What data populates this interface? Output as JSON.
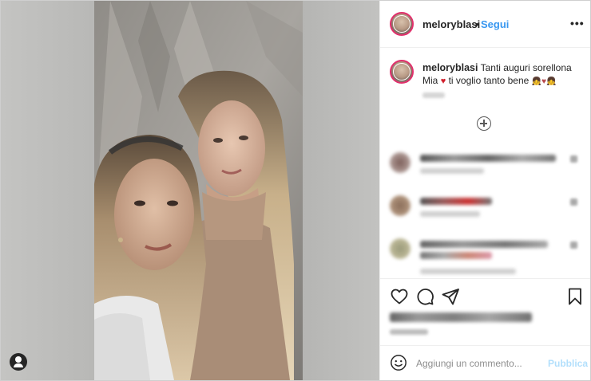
{
  "post": {
    "username": "meloryblasi",
    "dot": "•",
    "follow_label": "Segui",
    "more_label": "•••",
    "caption_username": "meloryblasi",
    "caption_text_1": "Tanti auguri sorellona",
    "caption_text_2_prefix": "Mia",
    "caption_heart": "♥",
    "caption_text_2_suffix": "ti voglio tanto bene",
    "caption_emojis": "👧♥👧"
  },
  "comment_box": {
    "placeholder": "Aggiungi un commento...",
    "publish_label": "Pubblica"
  },
  "icons": {
    "heart": "heart-icon",
    "comment": "comment-icon",
    "share": "paper-plane-icon",
    "save": "bookmark-icon",
    "emoji": "smiley-icon",
    "load_more": "plus-circle-icon",
    "user_tag": "user-tag-icon"
  },
  "colors": {
    "accent": "#3897f0",
    "publish_disabled": "#b2dffc",
    "story_ring": "#e1306c",
    "text": "#262626"
  }
}
